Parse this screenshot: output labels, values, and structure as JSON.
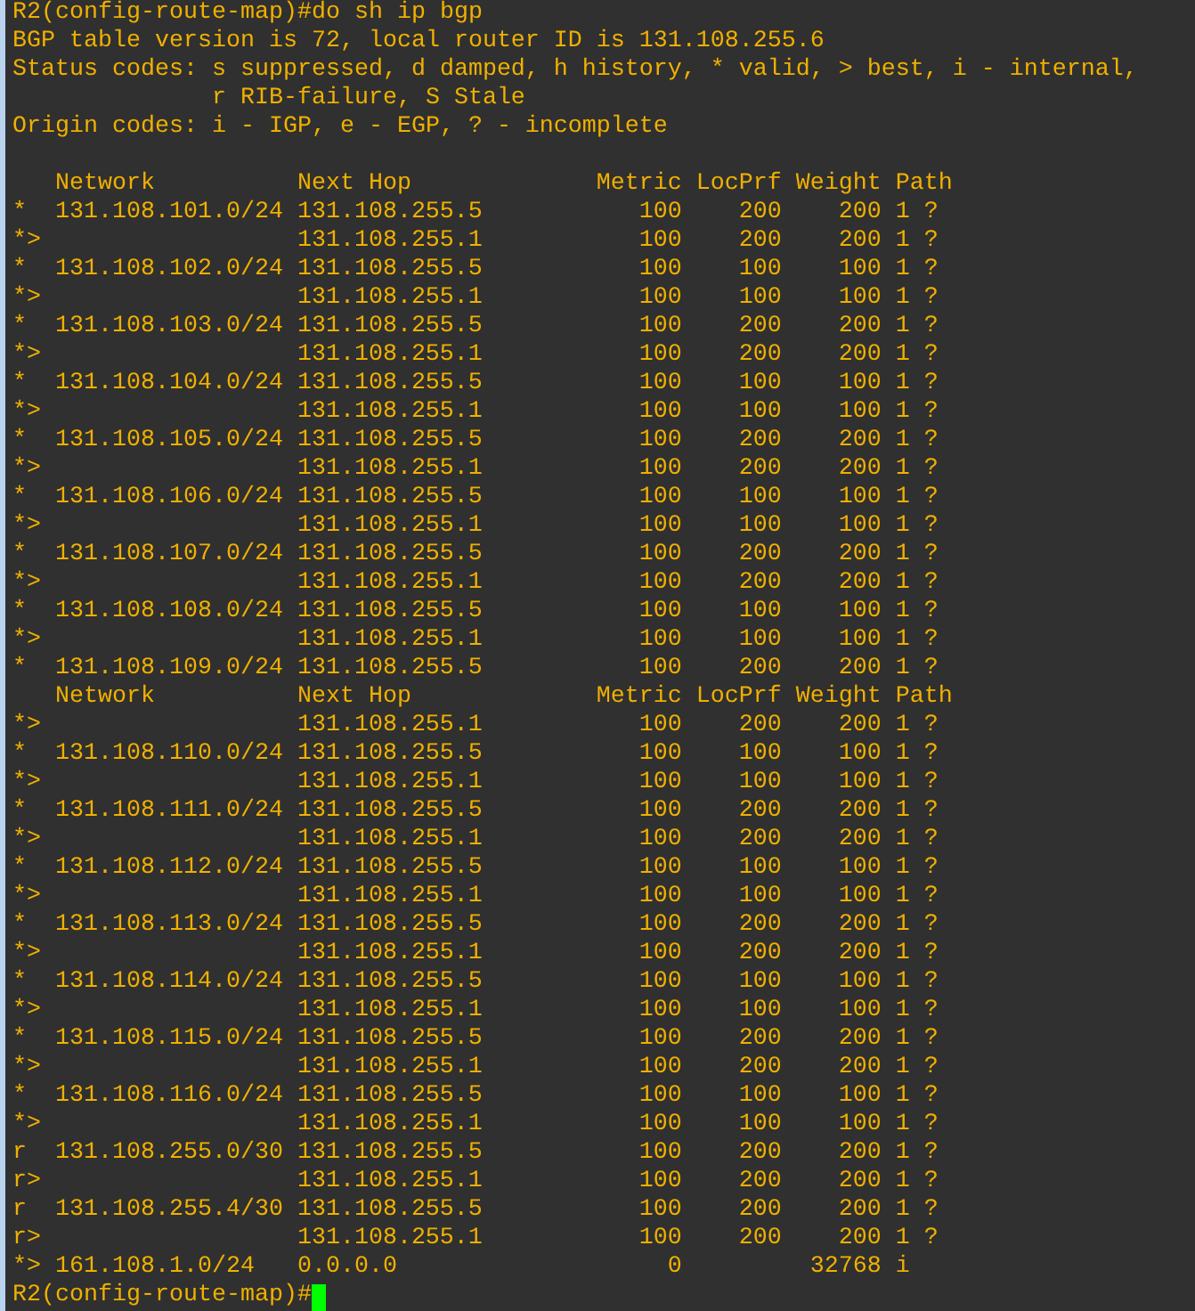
{
  "terminal": {
    "lines": [
      {
        "kind": "text",
        "text": "R2(config-route-map)#do sh ip bgp"
      },
      {
        "kind": "text",
        "text": "BGP table version is 72, local router ID is 131.108.255.6"
      },
      {
        "kind": "text",
        "text": "Status codes: s suppressed, d damped, h history, * valid, > best, i - internal,"
      },
      {
        "kind": "text",
        "text": "              r RIB-failure, S Stale"
      },
      {
        "kind": "text",
        "text": "Origin codes: i - IGP, e - EGP, ? - incomplete"
      },
      {
        "kind": "blank"
      },
      {
        "kind": "header",
        "network": "Network",
        "next_hop": "Next Hop",
        "metric": "Metric",
        "locprf": "LocPrf",
        "weight": "Weight",
        "path": "Path"
      },
      {
        "kind": "route",
        "status": "*",
        "network": "131.108.101.0/24",
        "next_hop": "131.108.255.5",
        "metric": "100",
        "locprf": "200",
        "weight": "200",
        "path": "1 ?"
      },
      {
        "kind": "route",
        "status": "*>",
        "next_hop": "131.108.255.1",
        "metric": "100",
        "locprf": "200",
        "weight": "200",
        "path": "1 ?"
      },
      {
        "kind": "route",
        "status": "*",
        "network": "131.108.102.0/24",
        "next_hop": "131.108.255.5",
        "metric": "100",
        "locprf": "100",
        "weight": "100",
        "path": "1 ?"
      },
      {
        "kind": "route",
        "status": "*>",
        "next_hop": "131.108.255.1",
        "metric": "100",
        "locprf": "100",
        "weight": "100",
        "path": "1 ?"
      },
      {
        "kind": "route",
        "status": "*",
        "network": "131.108.103.0/24",
        "next_hop": "131.108.255.5",
        "metric": "100",
        "locprf": "200",
        "weight": "200",
        "path": "1 ?"
      },
      {
        "kind": "route",
        "status": "*>",
        "next_hop": "131.108.255.1",
        "metric": "100",
        "locprf": "200",
        "weight": "200",
        "path": "1 ?"
      },
      {
        "kind": "route",
        "status": "*",
        "network": "131.108.104.0/24",
        "next_hop": "131.108.255.5",
        "metric": "100",
        "locprf": "100",
        "weight": "100",
        "path": "1 ?"
      },
      {
        "kind": "route",
        "status": "*>",
        "next_hop": "131.108.255.1",
        "metric": "100",
        "locprf": "100",
        "weight": "100",
        "path": "1 ?"
      },
      {
        "kind": "route",
        "status": "*",
        "network": "131.108.105.0/24",
        "next_hop": "131.108.255.5",
        "metric": "100",
        "locprf": "200",
        "weight": "200",
        "path": "1 ?"
      },
      {
        "kind": "route",
        "status": "*>",
        "next_hop": "131.108.255.1",
        "metric": "100",
        "locprf": "200",
        "weight": "200",
        "path": "1 ?"
      },
      {
        "kind": "route",
        "status": "*",
        "network": "131.108.106.0/24",
        "next_hop": "131.108.255.5",
        "metric": "100",
        "locprf": "100",
        "weight": "100",
        "path": "1 ?"
      },
      {
        "kind": "route",
        "status": "*>",
        "next_hop": "131.108.255.1",
        "metric": "100",
        "locprf": "100",
        "weight": "100",
        "path": "1 ?"
      },
      {
        "kind": "route",
        "status": "*",
        "network": "131.108.107.0/24",
        "next_hop": "131.108.255.5",
        "metric": "100",
        "locprf": "200",
        "weight": "200",
        "path": "1 ?"
      },
      {
        "kind": "route",
        "status": "*>",
        "next_hop": "131.108.255.1",
        "metric": "100",
        "locprf": "200",
        "weight": "200",
        "path": "1 ?"
      },
      {
        "kind": "route",
        "status": "*",
        "network": "131.108.108.0/24",
        "next_hop": "131.108.255.5",
        "metric": "100",
        "locprf": "100",
        "weight": "100",
        "path": "1 ?"
      },
      {
        "kind": "route",
        "status": "*>",
        "next_hop": "131.108.255.1",
        "metric": "100",
        "locprf": "100",
        "weight": "100",
        "path": "1 ?"
      },
      {
        "kind": "route",
        "status": "*",
        "network": "131.108.109.0/24",
        "next_hop": "131.108.255.5",
        "metric": "100",
        "locprf": "200",
        "weight": "200",
        "path": "1 ?"
      },
      {
        "kind": "header",
        "network": "Network",
        "next_hop": "Next Hop",
        "metric": "Metric",
        "locprf": "LocPrf",
        "weight": "Weight",
        "path": "Path"
      },
      {
        "kind": "route",
        "status": "*>",
        "next_hop": "131.108.255.1",
        "metric": "100",
        "locprf": "200",
        "weight": "200",
        "path": "1 ?"
      },
      {
        "kind": "route",
        "status": "*",
        "network": "131.108.110.0/24",
        "next_hop": "131.108.255.5",
        "metric": "100",
        "locprf": "100",
        "weight": "100",
        "path": "1 ?"
      },
      {
        "kind": "route",
        "status": "*>",
        "next_hop": "131.108.255.1",
        "metric": "100",
        "locprf": "100",
        "weight": "100",
        "path": "1 ?"
      },
      {
        "kind": "route",
        "status": "*",
        "network": "131.108.111.0/24",
        "next_hop": "131.108.255.5",
        "metric": "100",
        "locprf": "200",
        "weight": "200",
        "path": "1 ?"
      },
      {
        "kind": "route",
        "status": "*>",
        "next_hop": "131.108.255.1",
        "metric": "100",
        "locprf": "200",
        "weight": "200",
        "path": "1 ?"
      },
      {
        "kind": "route",
        "status": "*",
        "network": "131.108.112.0/24",
        "next_hop": "131.108.255.5",
        "metric": "100",
        "locprf": "100",
        "weight": "100",
        "path": "1 ?"
      },
      {
        "kind": "route",
        "status": "*>",
        "next_hop": "131.108.255.1",
        "metric": "100",
        "locprf": "100",
        "weight": "100",
        "path": "1 ?"
      },
      {
        "kind": "route",
        "status": "*",
        "network": "131.108.113.0/24",
        "next_hop": "131.108.255.5",
        "metric": "100",
        "locprf": "200",
        "weight": "200",
        "path": "1 ?"
      },
      {
        "kind": "route",
        "status": "*>",
        "next_hop": "131.108.255.1",
        "metric": "100",
        "locprf": "200",
        "weight": "200",
        "path": "1 ?"
      },
      {
        "kind": "route",
        "status": "*",
        "network": "131.108.114.0/24",
        "next_hop": "131.108.255.5",
        "metric": "100",
        "locprf": "100",
        "weight": "100",
        "path": "1 ?"
      },
      {
        "kind": "route",
        "status": "*>",
        "next_hop": "131.108.255.1",
        "metric": "100",
        "locprf": "100",
        "weight": "100",
        "path": "1 ?"
      },
      {
        "kind": "route",
        "status": "*",
        "network": "131.108.115.0/24",
        "next_hop": "131.108.255.5",
        "metric": "100",
        "locprf": "200",
        "weight": "200",
        "path": "1 ?"
      },
      {
        "kind": "route",
        "status": "*>",
        "next_hop": "131.108.255.1",
        "metric": "100",
        "locprf": "200",
        "weight": "200",
        "path": "1 ?"
      },
      {
        "kind": "route",
        "status": "*",
        "network": "131.108.116.0/24",
        "next_hop": "131.108.255.5",
        "metric": "100",
        "locprf": "100",
        "weight": "100",
        "path": "1 ?"
      },
      {
        "kind": "route",
        "status": "*>",
        "next_hop": "131.108.255.1",
        "metric": "100",
        "locprf": "100",
        "weight": "100",
        "path": "1 ?"
      },
      {
        "kind": "route",
        "status": "r",
        "network": "131.108.255.0/30",
        "next_hop": "131.108.255.5",
        "metric": "100",
        "locprf": "200",
        "weight": "200",
        "path": "1 ?"
      },
      {
        "kind": "route",
        "status": "r>",
        "next_hop": "131.108.255.1",
        "metric": "100",
        "locprf": "200",
        "weight": "200",
        "path": "1 ?"
      },
      {
        "kind": "route",
        "status": "r",
        "network": "131.108.255.4/30",
        "next_hop": "131.108.255.5",
        "metric": "100",
        "locprf": "200",
        "weight": "200",
        "path": "1 ?"
      },
      {
        "kind": "route",
        "status": "r>",
        "next_hop": "131.108.255.1",
        "metric": "100",
        "locprf": "200",
        "weight": "200",
        "path": "1 ?"
      },
      {
        "kind": "route",
        "status": "*>",
        "network": "161.108.1.0/24",
        "next_hop": "0.0.0.0",
        "metric": "0",
        "weight": "32768",
        "path": "i"
      },
      {
        "kind": "prompt",
        "text": "R2(config-route-map)#"
      }
    ]
  }
}
